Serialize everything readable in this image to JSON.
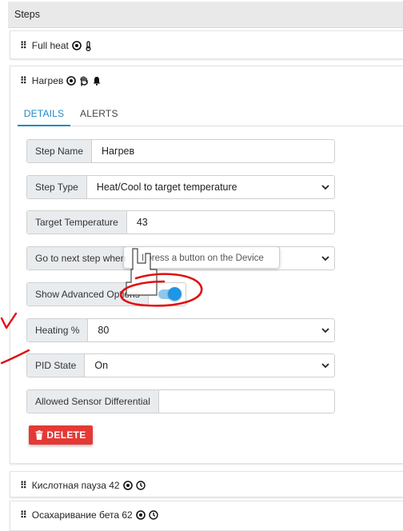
{
  "header": {
    "title": "Steps"
  },
  "steps": [
    {
      "name": "Full heat",
      "icons": [
        "target-icon",
        "thermometer-icon"
      ]
    },
    {
      "name": "Нагрев",
      "icons": [
        "target-icon",
        "hand-icon",
        "bell-icon"
      ]
    },
    {
      "name": "Кислотная пауза 42",
      "icons": [
        "target-icon",
        "clock-icon"
      ]
    },
    {
      "name": "Осахаривание бета 62",
      "icons": [
        "target-icon",
        "clock-icon"
      ]
    }
  ],
  "tabs": {
    "details": "DETAILS",
    "alerts": "ALERTS"
  },
  "form": {
    "step_name": {
      "label": "Step Name",
      "value": "Нагрев"
    },
    "step_type": {
      "label": "Step Type",
      "value": "Heat/Cool to target temperature"
    },
    "target_temperature": {
      "label": "Target Temperature",
      "value": "43"
    },
    "next_step": {
      "label": "Go to next step when",
      "value": ""
    },
    "advanced": {
      "label": "Show Advanced Options",
      "on": true
    },
    "heating": {
      "label": "Heating %",
      "value": "80"
    },
    "pid_state": {
      "label": "PID State",
      "value": "On"
    },
    "sensor_diff": {
      "label": "Allowed Sensor Differential",
      "value": ""
    }
  },
  "tooltip": {
    "text": "I press a button on the Device"
  },
  "delete_label": "DELETE",
  "colors": {
    "accent": "#1e88c8",
    "delete": "#e53935",
    "annotation": "#e01010"
  }
}
